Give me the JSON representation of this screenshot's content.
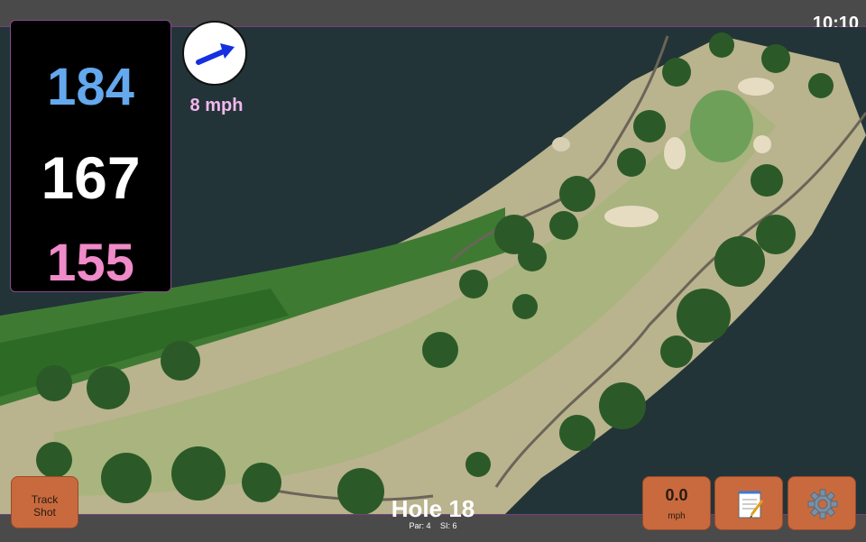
{
  "status_bar": {
    "time": "10:10"
  },
  "distances": {
    "back": "184",
    "middle": "167",
    "front": "155"
  },
  "wind": {
    "speed_label": "8 mph",
    "icon": "wind-direction-arrow-icon"
  },
  "hole": {
    "title": "Hole 18",
    "par_label": "Par: 4",
    "si_label": "SI: 6"
  },
  "buttons": {
    "track_shot_line1": "Track",
    "track_shot_line2": "Shot",
    "speed_value": "0.0",
    "speed_unit": "mph",
    "notes_icon": "notepad-icon",
    "settings_icon": "gear-icon"
  },
  "colors": {
    "back": "#64a8ee",
    "middle": "#ffffff",
    "front": "#f08ac8",
    "wind_text": "#f3b6ee",
    "button": "#c86a3e"
  }
}
